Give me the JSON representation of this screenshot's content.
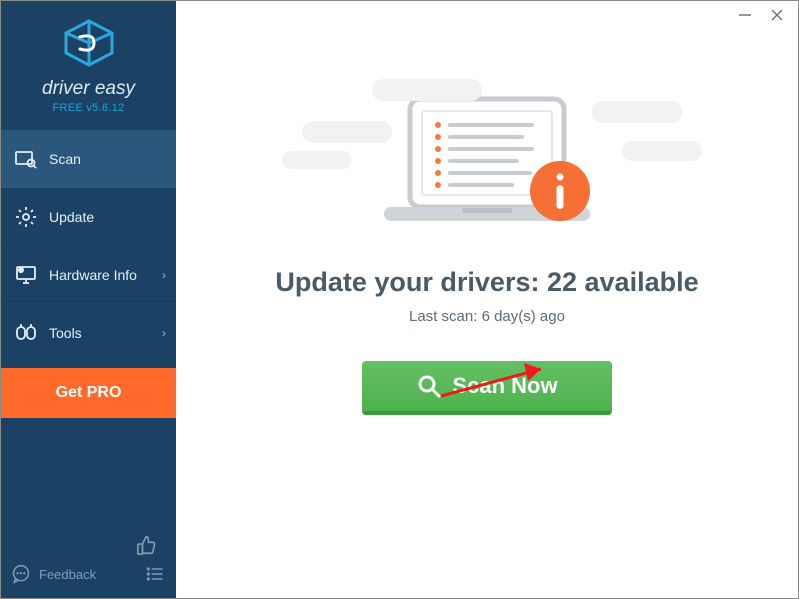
{
  "brand": {
    "name": "driver easy",
    "version_label": "FREE v5.6.12"
  },
  "sidebar": {
    "items": [
      {
        "label": "Scan",
        "has_chevron": false,
        "active": true
      },
      {
        "label": "Update",
        "has_chevron": false,
        "active": false
      },
      {
        "label": "Hardware Info",
        "has_chevron": true,
        "active": false
      },
      {
        "label": "Tools",
        "has_chevron": true,
        "active": false
      }
    ],
    "get_pro_label": "Get PRO",
    "feedback_label": "Feedback"
  },
  "main": {
    "headline_prefix": "Update your drivers: ",
    "available_count": 22,
    "headline_suffix": " available",
    "last_scan_prefix": "Last scan: ",
    "last_scan_value": "6 day(s) ago",
    "scan_button_label": "Scan Now"
  }
}
